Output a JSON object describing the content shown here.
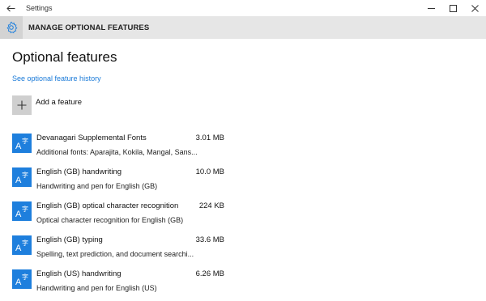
{
  "window": {
    "title": "Settings",
    "controls": [
      "minimize",
      "maximize",
      "close"
    ]
  },
  "header": {
    "title": "MANAGE OPTIONAL FEATURES",
    "icon": "gear-icon"
  },
  "main": {
    "title": "Optional features",
    "history_link": "See optional feature history",
    "add_feature": "Add a feature"
  },
  "features": [
    {
      "name": "Devanagari Supplemental Fonts",
      "size": "3.01 MB",
      "description": "Additional fonts: Aparajita, Kokila, Mangal, Sans..."
    },
    {
      "name": "English (GB) handwriting",
      "size": "10.0 MB",
      "description": "Handwriting and pen for English (GB)"
    },
    {
      "name": "English (GB) optical character recognition",
      "size": "224 KB",
      "description": "Optical character recognition for English (GB)"
    },
    {
      "name": "English (GB) typing",
      "size": "33.6 MB",
      "description": "Spelling, text prediction, and document searchi..."
    },
    {
      "name": "English (US) handwriting",
      "size": "6.26 MB",
      "description": "Handwriting and pen for English (US)"
    }
  ],
  "colors": {
    "accent": "#1e7fdd",
    "link": "#1a7ad8",
    "header_bg": "#e6e6e6"
  }
}
